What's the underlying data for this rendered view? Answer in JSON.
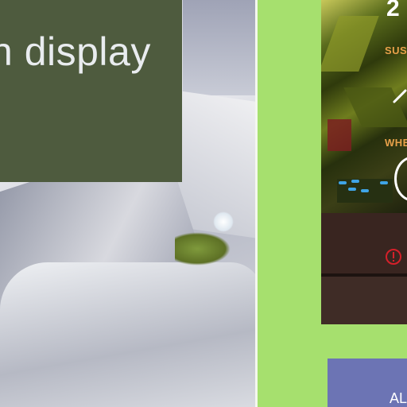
{
  "caption": {
    "text": "h display"
  },
  "card": {
    "top_glyph": "2",
    "label_top": "SUSP",
    "label_mid": "WHE",
    "icons": [
      "pen-icon",
      "ring-icon",
      "warning-icon"
    ],
    "accent_color": "#e8a14a",
    "warning_color": "#d5202a"
  },
  "action": {
    "label": "AL"
  },
  "colors": {
    "background": "#a6e06e",
    "caption_bg": "#4e5b3e",
    "card_bg": "#3a2a22",
    "action_bg": "#6c74b4"
  }
}
